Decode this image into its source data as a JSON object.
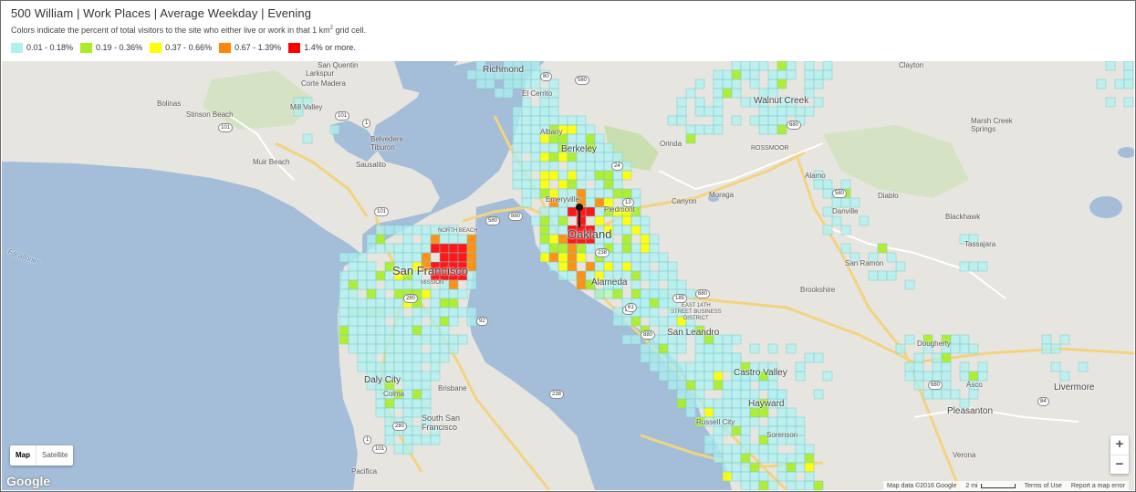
{
  "header": {
    "title": "500 William | Work Places | Average Weekday | Evening",
    "subtitle_prefix": "Colors indicate the percent of total visitors to the site who either live or work in that 1 km",
    "subtitle_sup": "2",
    "subtitle_suffix": " grid cell."
  },
  "legend": [
    {
      "label": "0.01 - 0.18%",
      "color": "#aef1f1"
    },
    {
      "label": "0.19 - 0.36%",
      "color": "#aaee22"
    },
    {
      "label": "0.37 - 0.66%",
      "color": "#ffff00"
    },
    {
      "label": "0.67 - 1.39%",
      "color": "#ff8800"
    },
    {
      "label": "1.4% or more.",
      "color": "#ff0000"
    }
  ],
  "colors": {
    "land": "#e7e5df",
    "water": "#a4bdd8",
    "park": "#c9dfb0",
    "road": "#ffffff",
    "highway": "#f3d37f"
  },
  "map": {
    "places": {
      "san_quentin": "San Quentin",
      "richmond": "Richmond",
      "clayton": "Clayton",
      "larkspur": "Larkspur",
      "corte_madera": "Corte Madera",
      "el_cerrito": "El Cerrito",
      "bolinas": "Bolinas",
      "stinson_beach": "Stinson Beach",
      "mill_valley": "Mill Valley",
      "walnut_creek": "Walnut Creek",
      "marsh_creek_springs": "Marsh Creek\nSprings",
      "albany": "Albany",
      "belvedere_tiburon": "Belvedere\nTiburon",
      "berkeley": "Berkeley",
      "orinda": "Orinda",
      "rossmoor": "ROSSMOOR",
      "muir_beach": "Muir Beach",
      "sausalito": "Sausalito",
      "alamo": "Alamo",
      "emeryville": "Emeryville",
      "piedmont": "Piedmont",
      "canyon": "Canyon",
      "moraga": "Moraga",
      "diablo": "Diablo",
      "danville": "Danville",
      "blackhawk": "Blackhawk",
      "oakland": "Oakland",
      "tassajara": "Tassajara",
      "farallones": "Farallones",
      "san_francisco": "San Francisco",
      "san_ramon": "San Ramon",
      "alameda": "Alameda",
      "brookshire": "Brookshire",
      "east_14th": "EAST 14TH\nSTREET BUSINESS\nDISTRICT",
      "mission": "MISSION",
      "north_beach": "NORTH BEACH",
      "san_leandro": "San Leandro",
      "dougherty": "Dougherty",
      "castro_valley": "Castro Valley",
      "daly_city": "Daly City",
      "livermore": "Livermore",
      "colma": "Colma",
      "brisbane": "Brisbane",
      "hayward": "Hayward",
      "asco": "Asco",
      "pleasanton": "Pleasanton",
      "south_san_francisco": "South San\nFrancisco",
      "russell_city": "Russell City",
      "sorenson": "Sorenson",
      "pacifica": "Pacifica",
      "verona": "Verona"
    },
    "routes": [
      "101",
      "1",
      "101",
      "80",
      "580",
      "24",
      "680",
      "880",
      "580",
      "13",
      "580",
      "238",
      "101",
      "280",
      "92",
      "84",
      "680",
      "880",
      "238",
      "61",
      "185",
      "280",
      "1",
      "101",
      "680",
      "84"
    ],
    "marker": "500 William",
    "controls": {
      "map_label": "Map",
      "satellite_label": "Satellite",
      "zoom_in": "+",
      "zoom_out": "−",
      "logo": "Google",
      "attribution": "Map data ©2016 Google",
      "scale": "2 mi",
      "terms": "Terms of Use",
      "report": "Report a map error"
    }
  },
  "grid_cells": {
    "cell_size_km": 1,
    "clusters": [
      {
        "area": "San Francisco",
        "level_counts": {
          "1": 140,
          "2": 14,
          "3": 6,
          "4": 5,
          "5": 6
        }
      },
      {
        "area": "Oakland / Berkeley",
        "level_counts": {
          "1": 160,
          "2": 22,
          "3": 26,
          "4": 14,
          "5": 2
        }
      },
      {
        "area": "Alameda / San Leandro / Hayward",
        "level_counts": {
          "1": 170,
          "2": 16,
          "3": 6
        }
      },
      {
        "area": "Walnut Creek / Danville / San Ramon",
        "level_counts": {
          "1": 40,
          "2": 3
        }
      },
      {
        "area": "Pleasanton / Dougherty / Livermore",
        "level_counts": {
          "1": 22,
          "2": 2
        }
      },
      {
        "area": "Marin / Richmond",
        "level_counts": {
          "1": 30,
          "2": 1
        }
      }
    ]
  }
}
